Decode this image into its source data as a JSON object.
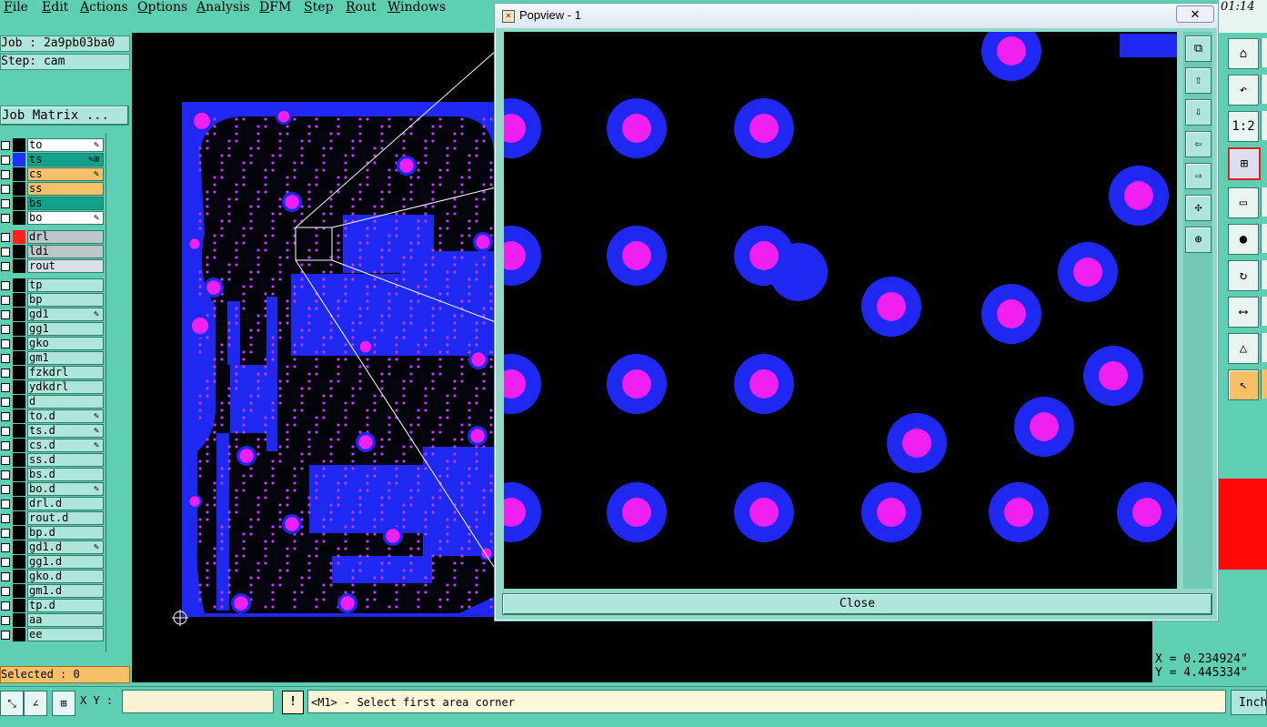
{
  "menu": [
    "File",
    "Edit",
    "Actions",
    "Options",
    "Analysis",
    "DFM",
    "Step",
    "Rout",
    "Windows"
  ],
  "clock": "01:14",
  "job": {
    "job_label": "Job : 2a9pb03ba0",
    "step_label": "Step: cam",
    "matrix_button": "Job Matrix ..."
  },
  "layers": [
    {
      "name": "to",
      "color": "#ffffff",
      "swatch": "#000000",
      "mark": "✎"
    },
    {
      "name": "ts",
      "color": "#12a28c",
      "swatch": "#1e32ff",
      "mark": "✎⊞"
    },
    {
      "name": "cs",
      "color": "#f7c068",
      "swatch": "#000000",
      "mark": "✎"
    },
    {
      "name": "ss",
      "color": "#f7c068",
      "swatch": "#000000",
      "mark": ""
    },
    {
      "name": "bs",
      "color": "#12a28c",
      "swatch": "#000000",
      "mark": ""
    },
    {
      "name": "bo",
      "color": "#ffffff",
      "swatch": "#000000",
      "mark": "✎"
    },
    {
      "name": "drl",
      "color": "#bcc6c9",
      "swatch": "#ff2020",
      "mark": ""
    },
    {
      "name": "ldi",
      "color": "#bcc6c9",
      "swatch": "#000000",
      "mark": ""
    },
    {
      "name": "rout",
      "color": "#d9e0e2",
      "swatch": "#000000",
      "mark": ""
    },
    {
      "name": "tp",
      "color": "#aee6dc",
      "swatch": "#000000",
      "mark": ""
    },
    {
      "name": "bp",
      "color": "#aee6dc",
      "swatch": "#000000",
      "mark": ""
    },
    {
      "name": "gd1",
      "color": "#aee6dc",
      "swatch": "#000000",
      "mark": "✎"
    },
    {
      "name": "gg1",
      "color": "#aee6dc",
      "swatch": "#000000",
      "mark": ""
    },
    {
      "name": "gko",
      "color": "#aee6dc",
      "swatch": "#000000",
      "mark": ""
    },
    {
      "name": "gm1",
      "color": "#aee6dc",
      "swatch": "#000000",
      "mark": ""
    },
    {
      "name": "fzkdrl",
      "color": "#aee6dc",
      "swatch": "#000000",
      "mark": ""
    },
    {
      "name": "ydkdrl",
      "color": "#aee6dc",
      "swatch": "#000000",
      "mark": ""
    },
    {
      "name": "d",
      "color": "#aee6dc",
      "swatch": "#000000",
      "mark": ""
    },
    {
      "name": "to.d",
      "color": "#aee6dc",
      "swatch": "#000000",
      "mark": "✎"
    },
    {
      "name": "ts.d",
      "color": "#aee6dc",
      "swatch": "#000000",
      "mark": "✎"
    },
    {
      "name": "cs.d",
      "color": "#aee6dc",
      "swatch": "#000000",
      "mark": "✎"
    },
    {
      "name": "ss.d",
      "color": "#aee6dc",
      "swatch": "#000000",
      "mark": ""
    },
    {
      "name": "bs.d",
      "color": "#aee6dc",
      "swatch": "#000000",
      "mark": ""
    },
    {
      "name": "bo.d",
      "color": "#aee6dc",
      "swatch": "#000000",
      "mark": "✎"
    },
    {
      "name": "drl.d",
      "color": "#aee6dc",
      "swatch": "#000000",
      "mark": ""
    },
    {
      "name": "rout.d",
      "color": "#aee6dc",
      "swatch": "#000000",
      "mark": ""
    },
    {
      "name": "bp.d",
      "color": "#aee6dc",
      "swatch": "#000000",
      "mark": ""
    },
    {
      "name": "gd1.d",
      "color": "#aee6dc",
      "swatch": "#000000",
      "mark": "✎"
    },
    {
      "name": "gg1.d",
      "color": "#aee6dc",
      "swatch": "#000000",
      "mark": ""
    },
    {
      "name": "gko.d",
      "color": "#aee6dc",
      "swatch": "#000000",
      "mark": ""
    },
    {
      "name": "gm1.d",
      "color": "#aee6dc",
      "swatch": "#000000",
      "mark": ""
    },
    {
      "name": "tp.d",
      "color": "#aee6dc",
      "swatch": "#000000",
      "mark": ""
    },
    {
      "name": "aa",
      "color": "#aee6dc",
      "swatch": "#000000",
      "mark": ""
    },
    {
      "name": "ee",
      "color": "#aee6dc",
      "swatch": "#000000",
      "mark": ""
    }
  ],
  "selected_label": "Selected : 0",
  "popview": {
    "title": "Popview - 1",
    "close_x": "✕",
    "close_button": "Close"
  },
  "coords": {
    "x": "X = 0.234924\"",
    "y": "Y = 4.445334\""
  },
  "bottom": {
    "xy_label": "X Y :",
    "xy_value": "",
    "message_button": "!",
    "message": "<M1> - Select first area corner",
    "units": "Inch"
  },
  "colors": {
    "copper": "#1e28f0",
    "pad": "#f020f0",
    "background": "#000000",
    "panel": "#5ecfb2"
  }
}
